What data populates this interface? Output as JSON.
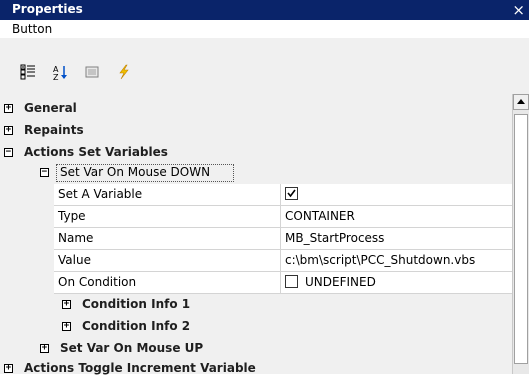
{
  "window": {
    "title": "Properties",
    "close_glyph": "×"
  },
  "object_type": "Button",
  "toolbar": {
    "buttons": [
      "categorized-icon",
      "alphabetical-icon",
      "property-pages-icon",
      "events-icon"
    ]
  },
  "tree": {
    "general": "General",
    "repaints": "Repaints",
    "actions_set_variables": "Actions Set Variables",
    "set_var_down": "Set Var On Mouse DOWN",
    "props": [
      {
        "name": "Set A Variable",
        "value": "",
        "checked": true
      },
      {
        "name": "Type",
        "value": "CONTAINER"
      },
      {
        "name": "Name",
        "value": "MB_StartProcess"
      },
      {
        "name": "Value",
        "value": "c:\\bm\\script\\PCC_Shutdown.vbs"
      },
      {
        "name": "On Condition",
        "value": "UNDEFINED",
        "checked": false
      }
    ],
    "condition_info_1": "Condition Info 1",
    "condition_info_2": "Condition Info 2",
    "set_var_up": "Set Var On Mouse UP",
    "actions_toggle": "Actions Toggle Increment Variable"
  },
  "colors": {
    "titlebar": "#0a246a",
    "grid_bg": "#f0f0f0",
    "row_bg": "#ffffff"
  }
}
